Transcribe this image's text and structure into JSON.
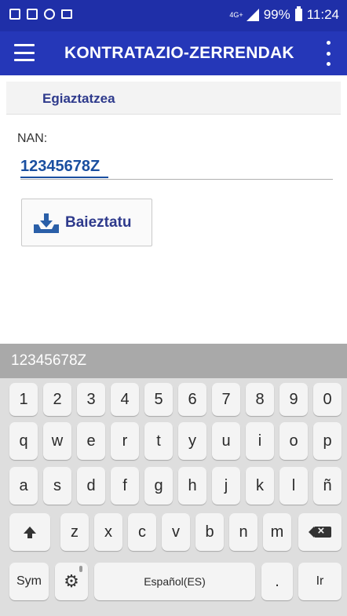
{
  "status_bar": {
    "network": "4G+",
    "battery": "99%",
    "time": "11:24"
  },
  "app_bar": {
    "title": "KONTRATAZIO-ZERRENDAK"
  },
  "section": {
    "title": "Egiaztatzea"
  },
  "nan_field": {
    "label": "NAN:",
    "value": "12345678Z"
  },
  "confirm_button": {
    "label": "Baieztatu",
    "icon": "download-tray-icon"
  },
  "accent_colors": {
    "app_bar": "#2537b8",
    "status_bar": "#1f2fa8",
    "field_text": "#1a4fa0",
    "button_text": "#2e3a8c"
  },
  "keyboard": {
    "suggestion": "12345678Z",
    "rows": [
      [
        "1",
        "2",
        "3",
        "4",
        "5",
        "6",
        "7",
        "8",
        "9",
        "0"
      ],
      [
        "q",
        "w",
        "e",
        "r",
        "t",
        "y",
        "u",
        "i",
        "o",
        "p"
      ],
      [
        "a",
        "s",
        "d",
        "f",
        "g",
        "h",
        "j",
        "k",
        "l",
        "ñ"
      ],
      [
        "z",
        "x",
        "c",
        "v",
        "b",
        "n",
        "m"
      ]
    ],
    "sym_label": "Sym",
    "space_label": "Español(ES)",
    "period_label": ".",
    "go_label": "Ir"
  }
}
